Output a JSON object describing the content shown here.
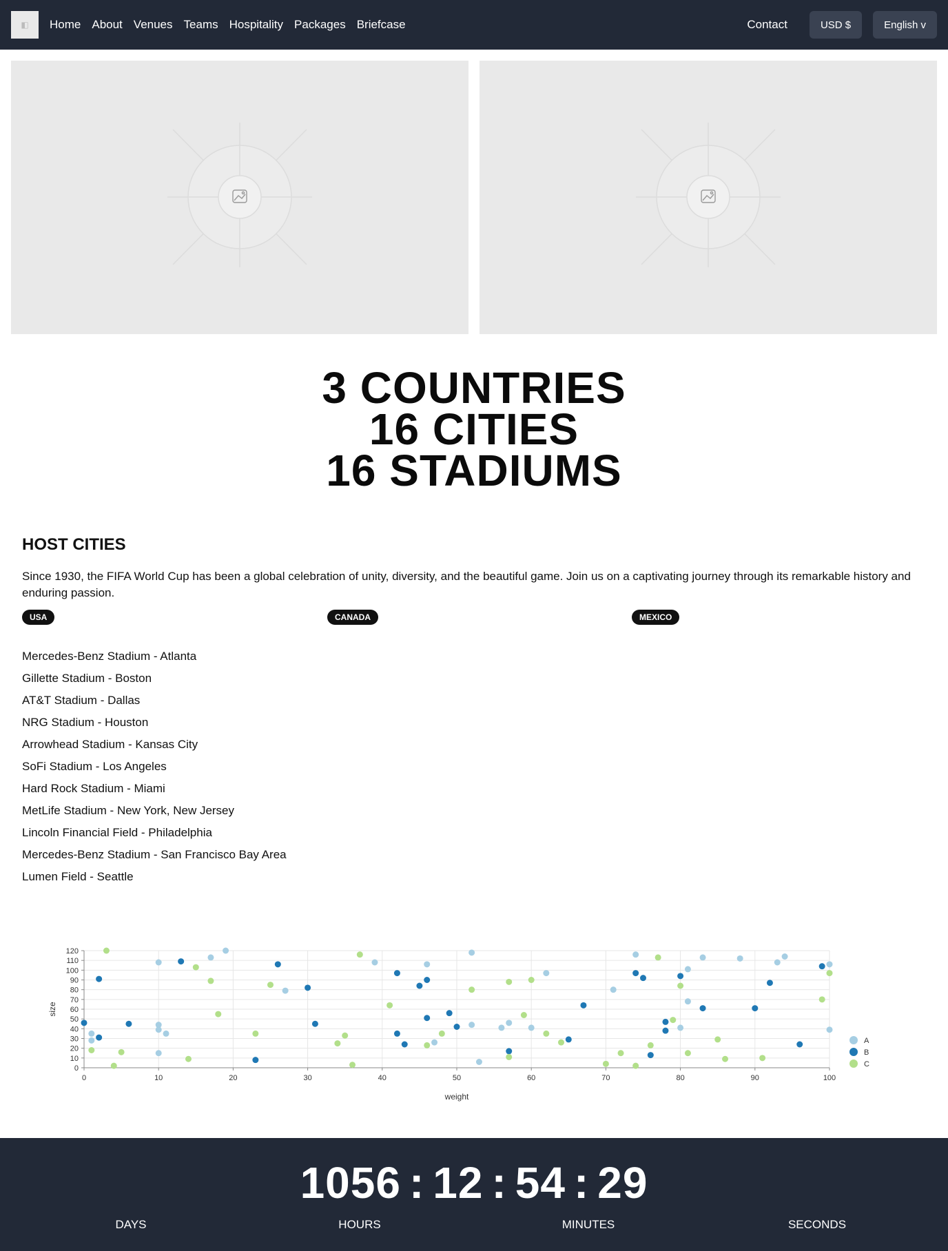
{
  "nav": {
    "items": [
      "Home",
      "About",
      "Venues",
      "Teams",
      "Hospitality",
      "Packages",
      "Briefcase"
    ],
    "contact": "Contact",
    "currency": "USD $",
    "language": "English v"
  },
  "headline": [
    "3 COUNTRIES",
    "16 CITIES",
    "16 STADIUMS"
  ],
  "host": {
    "title": "HOST CITIES",
    "description": "Since 1930, the FIFA World Cup has been a global celebration of unity, diversity, and the beautiful game. Join us on a captivating journey through its remarkable history and enduring passion.",
    "tabs": [
      "USA",
      "CANADA",
      "MEXICO"
    ],
    "stadiums": [
      "Mercedes-Benz Stadium - Atlanta",
      "Gillette Stadium - Boston",
      "AT&T Stadium - Dallas",
      "NRG Stadium - Houston",
      "Arrowhead Stadium - Kansas City",
      "SoFi Stadium - Los Angeles",
      "Hard Rock Stadium - Miami",
      "MetLife Stadium - New York, New Jersey",
      "Lincoln Financial Field - Philadelphia",
      "Mercedes-Benz Stadium - San Francisco Bay Area",
      "Lumen Field - Seattle"
    ]
  },
  "chart_data": {
    "type": "scatter",
    "xlabel": "weight",
    "ylabel": "size",
    "xlim": [
      0,
      100
    ],
    "ylim": [
      0,
      120
    ],
    "xticks": [
      0,
      10,
      20,
      30,
      40,
      50,
      60,
      70,
      80,
      90,
      100
    ],
    "yticks": [
      0,
      10,
      20,
      30,
      40,
      50,
      60,
      70,
      80,
      90,
      100,
      110,
      120
    ],
    "grid": true,
    "legend": "right",
    "series": [
      {
        "name": "A",
        "color": "#a6cee3",
        "points": [
          [
            1,
            35
          ],
          [
            1,
            28
          ],
          [
            10,
            108
          ],
          [
            10,
            44
          ],
          [
            10,
            39
          ],
          [
            10,
            15
          ],
          [
            11,
            35
          ],
          [
            17,
            113
          ],
          [
            19,
            120
          ],
          [
            27,
            79
          ],
          [
            39,
            108
          ],
          [
            46,
            106
          ],
          [
            47,
            26
          ],
          [
            52,
            118
          ],
          [
            52,
            44
          ],
          [
            53,
            6
          ],
          [
            56,
            41
          ],
          [
            57,
            46
          ],
          [
            60,
            41
          ],
          [
            62,
            97
          ],
          [
            71,
            80
          ],
          [
            74,
            116
          ],
          [
            81,
            101
          ],
          [
            81,
            68
          ],
          [
            80,
            41
          ],
          [
            83,
            113
          ],
          [
            88,
            112
          ],
          [
            93,
            108
          ],
          [
            94,
            114
          ],
          [
            100,
            106
          ],
          [
            100,
            39
          ]
        ]
      },
      {
        "name": "B",
        "color": "#1f78b4",
        "points": [
          [
            0,
            46
          ],
          [
            2,
            91
          ],
          [
            2,
            31
          ],
          [
            6,
            45
          ],
          [
            13,
            109
          ],
          [
            23,
            8
          ],
          [
            26,
            106
          ],
          [
            30,
            82
          ],
          [
            31,
            45
          ],
          [
            42,
            97
          ],
          [
            42,
            35
          ],
          [
            43,
            24
          ],
          [
            45,
            84
          ],
          [
            46,
            90
          ],
          [
            46,
            51
          ],
          [
            49,
            56
          ],
          [
            50,
            42
          ],
          [
            57,
            17
          ],
          [
            65,
            29
          ],
          [
            67,
            64
          ],
          [
            74,
            97
          ],
          [
            75,
            92
          ],
          [
            76,
            13
          ],
          [
            78,
            47
          ],
          [
            78,
            38
          ],
          [
            80,
            94
          ],
          [
            83,
            61
          ],
          [
            90,
            61
          ],
          [
            92,
            87
          ],
          [
            96,
            24
          ],
          [
            99,
            104
          ]
        ]
      },
      {
        "name": "C",
        "color": "#b2df8a",
        "points": [
          [
            1,
            18
          ],
          [
            3,
            120
          ],
          [
            4,
            2
          ],
          [
            5,
            16
          ],
          [
            14,
            9
          ],
          [
            15,
            103
          ],
          [
            17,
            89
          ],
          [
            18,
            55
          ],
          [
            23,
            35
          ],
          [
            25,
            85
          ],
          [
            34,
            25
          ],
          [
            35,
            33
          ],
          [
            36,
            3
          ],
          [
            37,
            116
          ],
          [
            41,
            64
          ],
          [
            46,
            23
          ],
          [
            48,
            35
          ],
          [
            52,
            80
          ],
          [
            57,
            88
          ],
          [
            57,
            11
          ],
          [
            59,
            54
          ],
          [
            60,
            90
          ],
          [
            62,
            35
          ],
          [
            64,
            26
          ],
          [
            70,
            4
          ],
          [
            72,
            15
          ],
          [
            74,
            2
          ],
          [
            76,
            23
          ],
          [
            77,
            113
          ],
          [
            79,
            49
          ],
          [
            80,
            84
          ],
          [
            81,
            15
          ],
          [
            85,
            29
          ],
          [
            86,
            9
          ],
          [
            91,
            10
          ],
          [
            99,
            70
          ],
          [
            100,
            97
          ]
        ]
      }
    ]
  },
  "countdown": {
    "days": "1056",
    "hours": "12",
    "minutes": "54",
    "seconds": "29",
    "labels": [
      "DAYS",
      "HOURS",
      "MINUTES",
      "SECONDS"
    ]
  }
}
